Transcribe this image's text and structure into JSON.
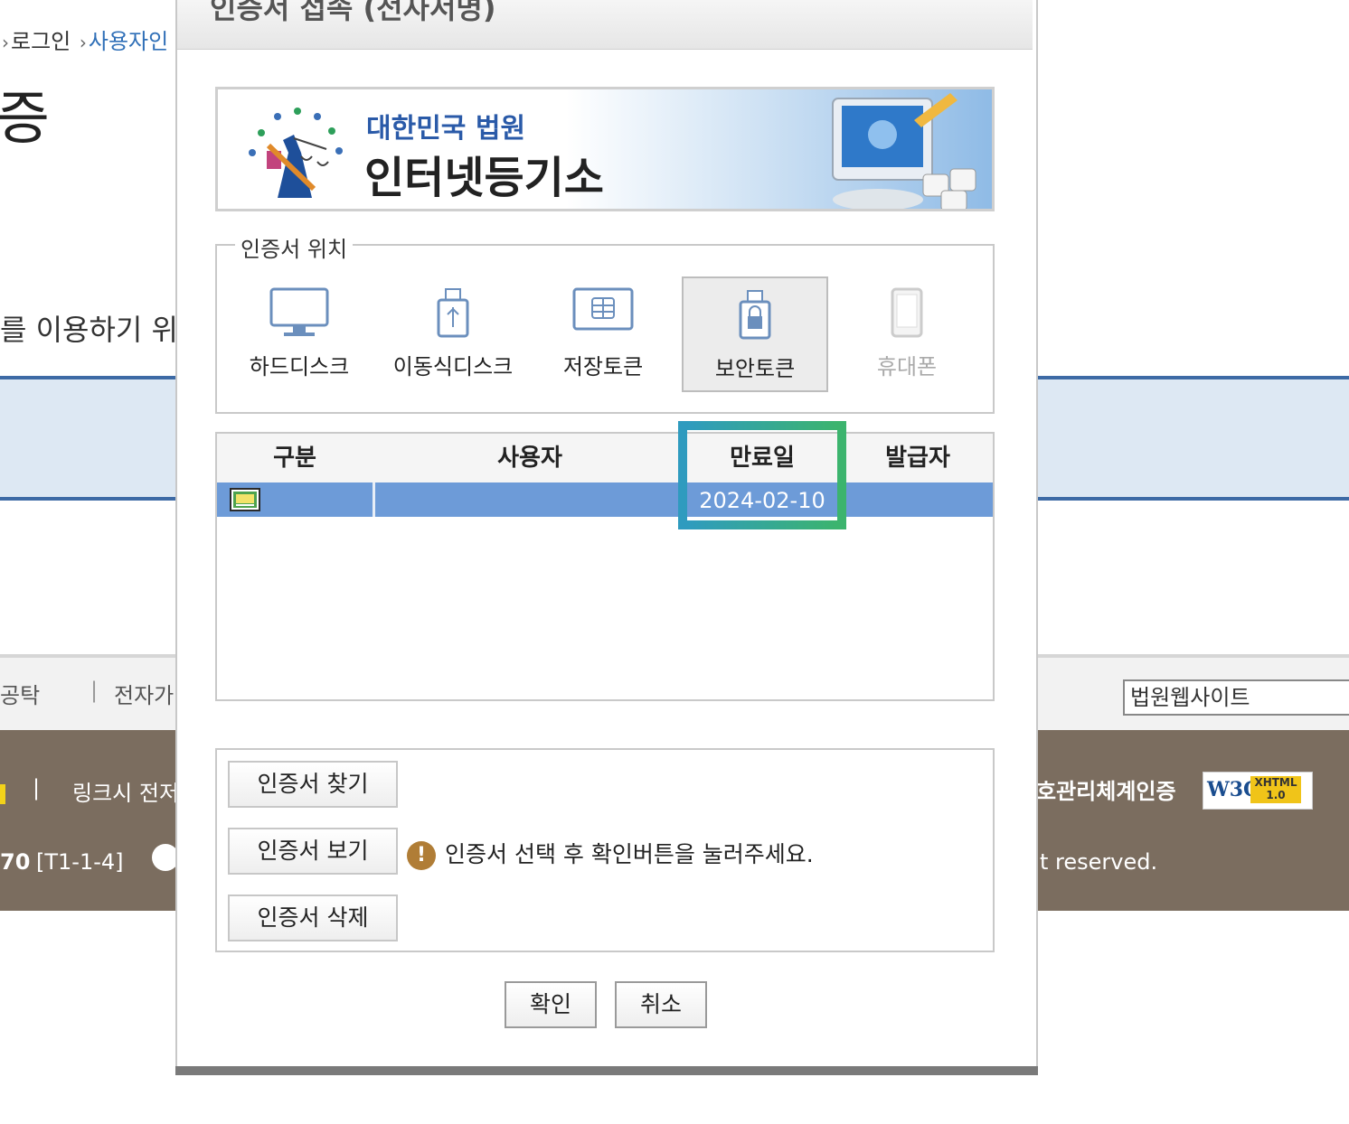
{
  "background": {
    "breadcrumb": {
      "item1": "로그인",
      "item2": "사용자인"
    },
    "page_title": "증",
    "intro_text": "를 이용하기 위",
    "footer_links": {
      "link1": "공탁",
      "link2": "전자가"
    },
    "site_select": {
      "value": "법원웹사이트"
    },
    "footer": {
      "link_notice": "링크시 전저",
      "code_prefix": "70",
      "code": "[T1-1-4]",
      "cert_text": "호관리체계인증",
      "rights_text": "t reserved.",
      "w3c_label": "W3C",
      "xhtml_label": "XHTML 1.0"
    }
  },
  "dialog": {
    "title": "인증서 접속 (전자서명)",
    "banner": {
      "line1": "대한민국 법원",
      "line2": "인터넷등기소"
    },
    "location": {
      "legend": "인증서 위치",
      "items": [
        {
          "label": "하드디스크",
          "icon": "monitor-icon",
          "state": "normal"
        },
        {
          "label": "이동식디스크",
          "icon": "usb-icon",
          "state": "normal"
        },
        {
          "label": "저장토큰",
          "icon": "smartcard-icon",
          "state": "normal"
        },
        {
          "label": "보안토큰",
          "icon": "security-token-icon",
          "state": "selected"
        },
        {
          "label": "휴대폰",
          "icon": "phone-icon",
          "state": "disabled"
        }
      ]
    },
    "table": {
      "headers": [
        "구분",
        "사용자",
        "만료일",
        "발급자"
      ],
      "rows": [
        {
          "type_icon": "certificate-icon",
          "user": "",
          "expiry": "2024-02-10",
          "issuer": ""
        }
      ],
      "selected_row": 0
    },
    "actions": {
      "find": "인증서 찾기",
      "view": "인증서 보기",
      "delete": "인증서 삭제",
      "hint": "인증서 선택 후 확인버튼을 눌러주세요."
    },
    "ok": "확인",
    "cancel": "취소"
  },
  "colors": {
    "selected_row": "#6d9bd8",
    "footer_bg": "#7b6d5f",
    "highlight_start": "#2f9bbf",
    "highlight_end": "#3cb46e",
    "accent_blue": "#3d6aa5"
  }
}
